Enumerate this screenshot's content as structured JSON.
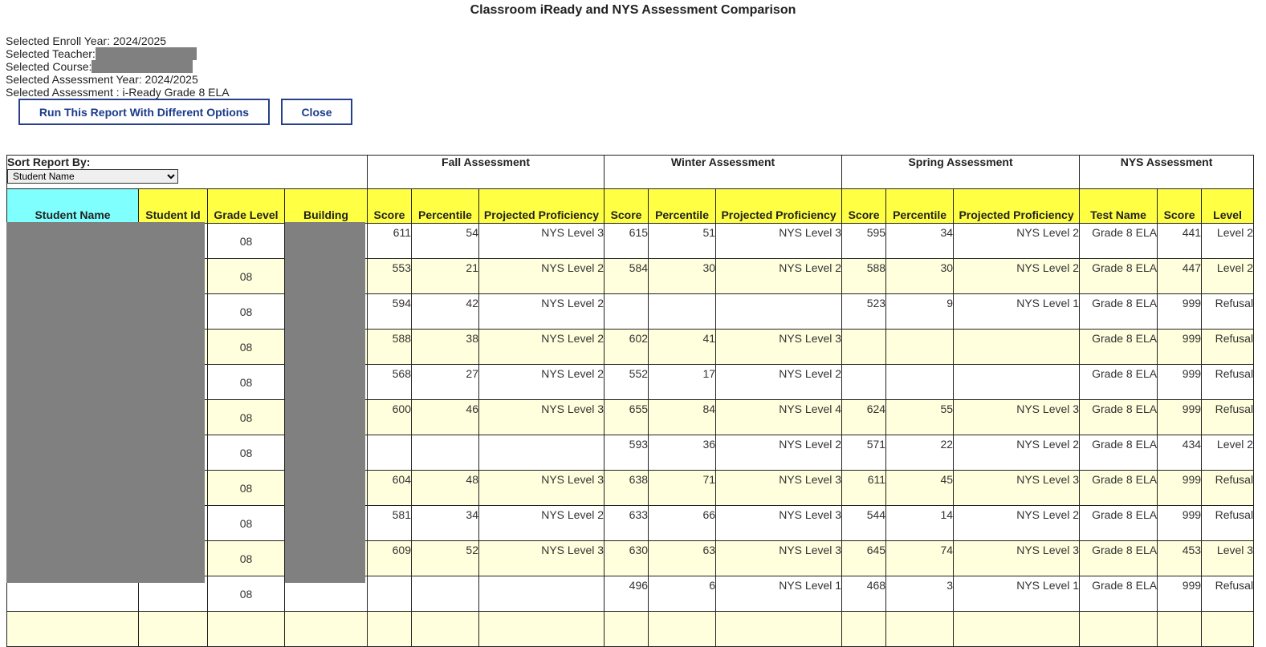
{
  "title": "Classroom iReady and NYS Assessment Comparison",
  "info": {
    "enroll_year": "Selected Enroll Year: 2024/2025",
    "teacher": "Selected Teacher:",
    "course": "Selected Course:",
    "assessment_year": "Selected Assessment Year: 2024/2025",
    "assessment": "Selected Assessment : i-Ready Grade 8 ELA"
  },
  "buttons": {
    "options": "Run This Report With Different Options",
    "close": "Close"
  },
  "sort": {
    "label": "Sort Report By:",
    "selected": "Student Name"
  },
  "groups": {
    "fall": "Fall Assessment",
    "winter": "Winter Assessment",
    "spring": "Spring Assessment",
    "nys": "NYS Assessment"
  },
  "columns": {
    "student_name": "Student Name",
    "student_id": "Student Id",
    "grade_level": "Grade Level",
    "building": "Building",
    "score": "Score",
    "percentile": "Percentile",
    "projected": "Projected Proficiency",
    "test_name": "Test Name",
    "level": "Level"
  },
  "rows": [
    {
      "grade": "08",
      "f_score": "611",
      "f_pct": "54",
      "f_prof": "NYS Level 3",
      "w_score": "615",
      "w_pct": "51",
      "w_prof": "NYS Level 3",
      "s_score": "595",
      "s_pct": "34",
      "s_prof": "NYS Level 2",
      "test": "Grade 8 ELA",
      "n_score": "441",
      "n_level": "Level 2"
    },
    {
      "grade": "08",
      "f_score": "553",
      "f_pct": "21",
      "f_prof": "NYS Level 2",
      "w_score": "584",
      "w_pct": "30",
      "w_prof": "NYS Level 2",
      "s_score": "588",
      "s_pct": "30",
      "s_prof": "NYS Level 2",
      "test": "Grade 8 ELA",
      "n_score": "447",
      "n_level": "Level 2"
    },
    {
      "grade": "08",
      "f_score": "594",
      "f_pct": "42",
      "f_prof": "NYS Level 2",
      "w_score": "",
      "w_pct": "",
      "w_prof": "",
      "s_score": "523",
      "s_pct": "9",
      "s_prof": "NYS Level 1",
      "test": "Grade 8 ELA",
      "n_score": "999",
      "n_level": "Refusal"
    },
    {
      "grade": "08",
      "f_score": "588",
      "f_pct": "38",
      "f_prof": "NYS Level 2",
      "w_score": "602",
      "w_pct": "41",
      "w_prof": "NYS Level 3",
      "s_score": "",
      "s_pct": "",
      "s_prof": "",
      "test": "Grade 8 ELA",
      "n_score": "999",
      "n_level": "Refusal"
    },
    {
      "grade": "08",
      "f_score": "568",
      "f_pct": "27",
      "f_prof": "NYS Level 2",
      "w_score": "552",
      "w_pct": "17",
      "w_prof": "NYS Level 2",
      "s_score": "",
      "s_pct": "",
      "s_prof": "",
      "test": "Grade 8 ELA",
      "n_score": "999",
      "n_level": "Refusal"
    },
    {
      "grade": "08",
      "f_score": "600",
      "f_pct": "46",
      "f_prof": "NYS Level 3",
      "w_score": "655",
      "w_pct": "84",
      "w_prof": "NYS Level 4",
      "s_score": "624",
      "s_pct": "55",
      "s_prof": "NYS Level 3",
      "test": "Grade 8 ELA",
      "n_score": "999",
      "n_level": "Refusal"
    },
    {
      "grade": "08",
      "f_score": "",
      "f_pct": "",
      "f_prof": "",
      "w_score": "593",
      "w_pct": "36",
      "w_prof": "NYS Level 2",
      "s_score": "571",
      "s_pct": "22",
      "s_prof": "NYS Level 2",
      "test": "Grade 8 ELA",
      "n_score": "434",
      "n_level": "Level 2"
    },
    {
      "grade": "08",
      "f_score": "604",
      "f_pct": "48",
      "f_prof": "NYS Level 3",
      "w_score": "638",
      "w_pct": "71",
      "w_prof": "NYS Level 3",
      "s_score": "611",
      "s_pct": "45",
      "s_prof": "NYS Level 3",
      "test": "Grade 8 ELA",
      "n_score": "999",
      "n_level": "Refusal"
    },
    {
      "grade": "08",
      "f_score": "581",
      "f_pct": "34",
      "f_prof": "NYS Level 2",
      "w_score": "633",
      "w_pct": "66",
      "w_prof": "NYS Level 3",
      "s_score": "544",
      "s_pct": "14",
      "s_prof": "NYS Level 2",
      "test": "Grade 8 ELA",
      "n_score": "999",
      "n_level": "Refusal"
    },
    {
      "grade": "08",
      "f_score": "609",
      "f_pct": "52",
      "f_prof": "NYS Level 3",
      "w_score": "630",
      "w_pct": "63",
      "w_prof": "NYS Level 3",
      "s_score": "645",
      "s_pct": "74",
      "s_prof": "NYS Level 3",
      "test": "Grade 8 ELA",
      "n_score": "453",
      "n_level": "Level 3"
    },
    {
      "grade": "08",
      "f_score": "",
      "f_pct": "",
      "f_prof": "",
      "w_score": "496",
      "w_pct": "6",
      "w_prof": "NYS Level 1",
      "s_score": "468",
      "s_pct": "3",
      "s_prof": "NYS Level 1",
      "test": "Grade 8 ELA",
      "n_score": "999",
      "n_level": "Refusal"
    },
    {
      "grade": "",
      "f_score": "",
      "f_pct": "",
      "f_prof": "",
      "w_score": "",
      "w_pct": "",
      "w_prof": "",
      "s_score": "",
      "s_pct": "",
      "s_prof": "",
      "test": "",
      "n_score": "",
      "n_level": ""
    }
  ]
}
